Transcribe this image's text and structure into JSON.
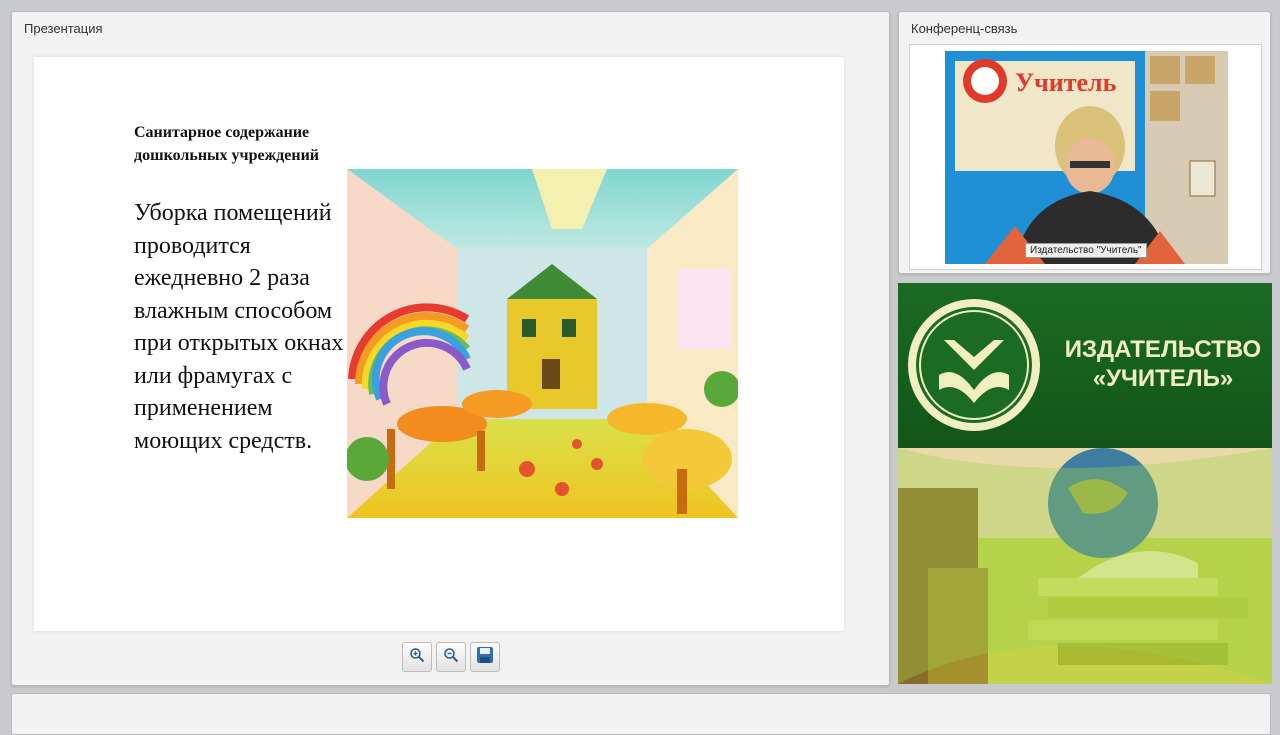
{
  "presentation": {
    "panel_title": "Презентация",
    "slide": {
      "heading": "Санитарное содержание дошкольных учреждений",
      "body": "Уборка помещений проводится ежедневно 2 раза влажным способом при открытых окнах или фрамугах с применением моющих средств."
    },
    "toolbar": {
      "zoom_in_icon": "zoom-in-icon",
      "zoom_out_icon": "zoom-out-icon",
      "save_icon": "save-icon"
    }
  },
  "conference": {
    "panel_title": "Конференц-связь",
    "video_caption": "Издательство \"Учитель\""
  },
  "banner": {
    "name_line1": "ИЗДАТЕЛЬСТВО",
    "name_line2": "«УЧИТЕЛЬ»",
    "accent": "#1b6b22"
  }
}
